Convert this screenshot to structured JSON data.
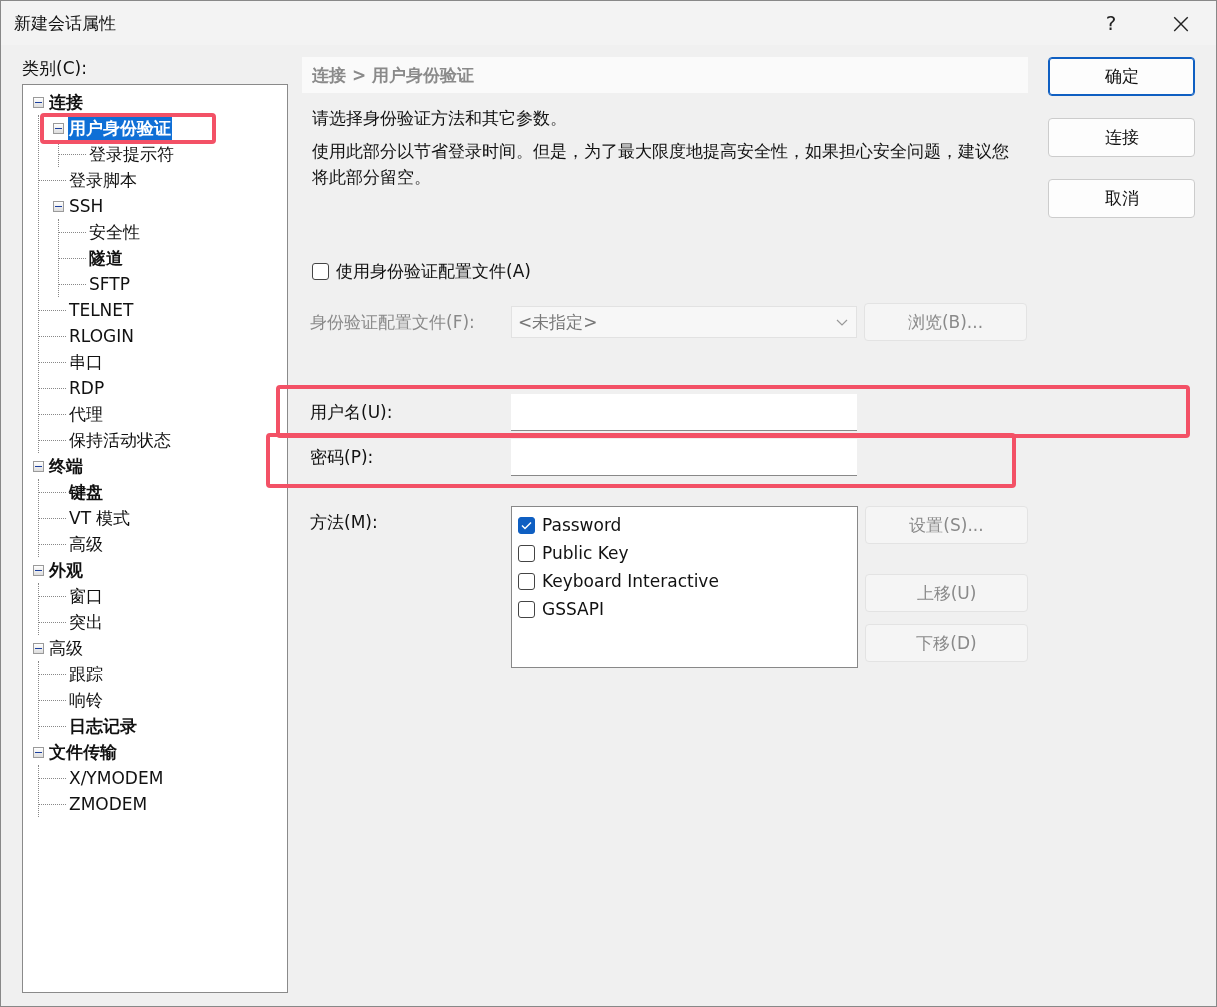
{
  "window": {
    "title": "新建会话属性",
    "help": "?",
    "close": "×"
  },
  "category_label": "类别(C):",
  "tree": [
    {
      "label": "连接",
      "bold": true,
      "selected": false,
      "expanded": true,
      "children": [
        {
          "label": "用户身份验证",
          "bold": true,
          "selected": true,
          "highlighted": true,
          "expanded": true,
          "children": [
            {
              "label": "登录提示符",
              "bold": false,
              "selected": false
            }
          ]
        },
        {
          "label": "登录脚本",
          "bold": false,
          "selected": false
        },
        {
          "label": "SSH",
          "bold": false,
          "selected": false,
          "expanded": true,
          "children": [
            {
              "label": "安全性",
              "bold": false,
              "selected": false
            },
            {
              "label": "隧道",
              "bold": true,
              "selected": false
            },
            {
              "label": "SFTP",
              "bold": false,
              "selected": false
            }
          ]
        },
        {
          "label": "TELNET",
          "bold": false,
          "selected": false
        },
        {
          "label": "RLOGIN",
          "bold": false,
          "selected": false
        },
        {
          "label": "串口",
          "bold": false,
          "selected": false
        },
        {
          "label": "RDP",
          "bold": false,
          "selected": false
        },
        {
          "label": "代理",
          "bold": false,
          "selected": false
        },
        {
          "label": "保持活动状态",
          "bold": false,
          "selected": false
        }
      ]
    },
    {
      "label": "终端",
      "bold": true,
      "selected": false,
      "expanded": true,
      "children": [
        {
          "label": "键盘",
          "bold": true,
          "selected": false
        },
        {
          "label": "VT 模式",
          "bold": false,
          "selected": false
        },
        {
          "label": "高级",
          "bold": false,
          "selected": false
        }
      ]
    },
    {
      "label": "外观",
      "bold": true,
      "selected": false,
      "expanded": true,
      "children": [
        {
          "label": "窗口",
          "bold": false,
          "selected": false
        },
        {
          "label": "突出",
          "bold": false,
          "selected": false
        }
      ]
    },
    {
      "label": "高级",
      "bold": false,
      "selected": false,
      "expanded": true,
      "children": [
        {
          "label": "跟踪",
          "bold": false,
          "selected": false
        },
        {
          "label": "响铃",
          "bold": false,
          "selected": false
        },
        {
          "label": "日志记录",
          "bold": true,
          "selected": false
        }
      ]
    },
    {
      "label": "文件传输",
      "bold": true,
      "selected": false,
      "expanded": true,
      "children": [
        {
          "label": "X/YMODEM",
          "bold": false,
          "selected": false
        },
        {
          "label": "ZMODEM",
          "bold": false,
          "selected": false
        }
      ]
    }
  ],
  "breadcrumb": "连接 > 用户身份验证",
  "intro": "请选择身份验证方法和其它参数。",
  "description": "使用此部分以节省登录时间。但是，为了最大限度地提高安全性，如果担心安全问题，建议您将此部分留空。",
  "profile_checkbox": {
    "label": "使用身份验证配置文件(A)",
    "checked": false
  },
  "profile": {
    "label": "身份验证配置文件(F):",
    "value": "<未指定>",
    "disabled": true,
    "browse": {
      "label": "浏览(B)...",
      "disabled": true
    }
  },
  "username": {
    "label": "用户名(U):",
    "highlighted": true
  },
  "password": {
    "label": "密码(P):",
    "highlighted": true
  },
  "method": {
    "label": "方法(M):",
    "options": [
      {
        "label": "Password",
        "checked": true
      },
      {
        "label": "Public Key",
        "checked": false
      },
      {
        "label": "Keyboard Interactive",
        "checked": false
      },
      {
        "label": "GSSAPI",
        "checked": false
      }
    ],
    "buttons": [
      {
        "label": "设置(S)...",
        "disabled": true
      },
      {
        "label": "上移(U)",
        "disabled": true
      },
      {
        "label": "下移(D)",
        "disabled": true
      }
    ]
  },
  "buttons": [
    {
      "label": "确定",
      "default": true
    },
    {
      "label": "连接",
      "default": false
    },
    {
      "label": "取消",
      "default": false
    }
  ]
}
